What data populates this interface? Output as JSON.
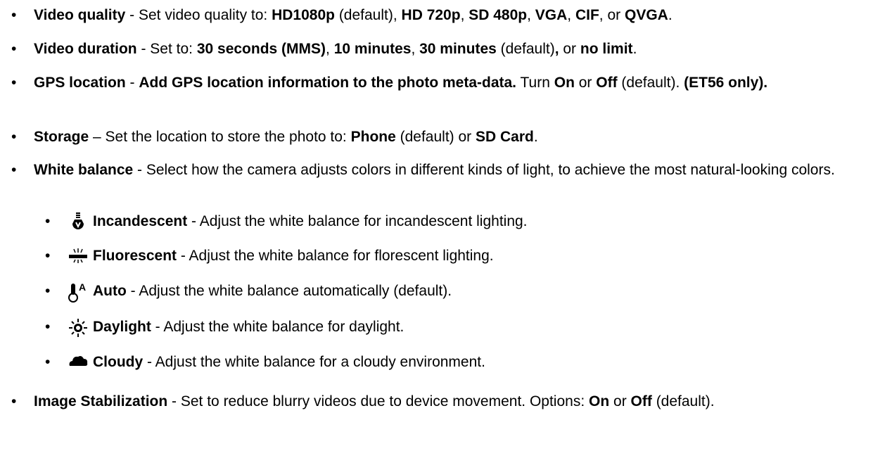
{
  "items": [
    {
      "parts": [
        {
          "t": "Video quality",
          "b": true
        },
        {
          "t": " - Set video quality to: ",
          "b": false
        },
        {
          "t": "HD1080p",
          "b": true
        },
        {
          "t": " (default), ",
          "b": false
        },
        {
          "t": "HD 720p",
          "b": true
        },
        {
          "t": ", ",
          "b": false
        },
        {
          "t": "SD 480p",
          "b": true
        },
        {
          "t": ", ",
          "b": false
        },
        {
          "t": "VGA",
          "b": true
        },
        {
          "t": ", ",
          "b": false
        },
        {
          "t": "CIF",
          "b": true
        },
        {
          "t": ", or ",
          "b": false
        },
        {
          "t": "QVGA",
          "b": true
        },
        {
          "t": ".",
          "b": false
        }
      ]
    },
    {
      "parts": [
        {
          "t": "Video duration",
          "b": true
        },
        {
          "t": " - Set to: ",
          "b": false
        },
        {
          "t": "30 seconds (MMS)",
          "b": true
        },
        {
          "t": ", ",
          "b": false
        },
        {
          "t": "10 minutes",
          "b": true
        },
        {
          "t": ", ",
          "b": false
        },
        {
          "t": "30 minutes",
          "b": true
        },
        {
          "t": " (default)",
          "b": false
        },
        {
          "t": ",",
          "b": true
        },
        {
          "t": " or ",
          "b": false
        },
        {
          "t": "no limit",
          "b": true
        },
        {
          "t": ".",
          "b": false
        }
      ]
    },
    {
      "parts": [
        {
          "t": "GPS location",
          "b": true
        },
        {
          "t": " - ",
          "b": false
        },
        {
          "t": "Add GPS location information to the photo meta-data.",
          "b": true
        },
        {
          "t": " Turn ",
          "b": false
        },
        {
          "t": "On",
          "b": true
        },
        {
          "t": " or ",
          "b": false
        },
        {
          "t": "Off",
          "b": true
        },
        {
          "t": " (default). ",
          "b": false
        },
        {
          "t": "(ET56 only).",
          "b": true
        }
      ]
    },
    {
      "parts": [
        {
          "t": "Storage",
          "b": true
        },
        {
          "t": " – Set the location to store the photo to: ",
          "b": false
        },
        {
          "t": "Phone",
          "b": true
        },
        {
          "t": " (default) or ",
          "b": false
        },
        {
          "t": "SD Card",
          "b": true
        },
        {
          "t": ".",
          "b": false
        }
      ]
    },
    {
      "parts": [
        {
          "t": "White balance",
          "b": true
        },
        {
          "t": " - Select how the camera adjusts colors in different kinds of light, to achieve the most natural-looking colors.",
          "b": false
        }
      ]
    },
    {
      "icon": "incandescent-bulb-icon",
      "parts": [
        {
          "t": "Incandescent",
          "b": true
        },
        {
          "t": " - Adjust the white balance for incandescent lighting.",
          "b": false
        }
      ]
    },
    {
      "icon": "fluorescent-tube-icon",
      "parts": [
        {
          "t": "Fluorescent",
          "b": true
        },
        {
          "t": " - Adjust the white balance for florescent lighting.",
          "b": false
        }
      ]
    },
    {
      "icon": "auto-white-balance-icon",
      "parts": [
        {
          "t": "Auto",
          "b": true
        },
        {
          "t": " - Adjust the white balance automatically (default).",
          "b": false
        }
      ]
    },
    {
      "icon": "daylight-sun-icon",
      "parts": [
        {
          "t": "Daylight",
          "b": true
        },
        {
          "t": " - Adjust the white balance for daylight.",
          "b": false
        }
      ]
    },
    {
      "icon": "cloudy-icon",
      "parts": [
        {
          "t": "Cloudy",
          "b": true
        },
        {
          "t": " - Adjust the white balance for a cloudy environment.",
          "b": false
        }
      ]
    },
    {
      "parts": [
        {
          "t": "Image Stabilization",
          "b": true
        },
        {
          "t": " - Set to reduce blurry videos due to device movement. Options: ",
          "b": false
        },
        {
          "t": "On",
          "b": true
        },
        {
          "t": " or ",
          "b": false
        },
        {
          "t": "Off",
          "b": true
        },
        {
          "t": " (default).",
          "b": false
        }
      ]
    }
  ],
  "bullet": "•"
}
